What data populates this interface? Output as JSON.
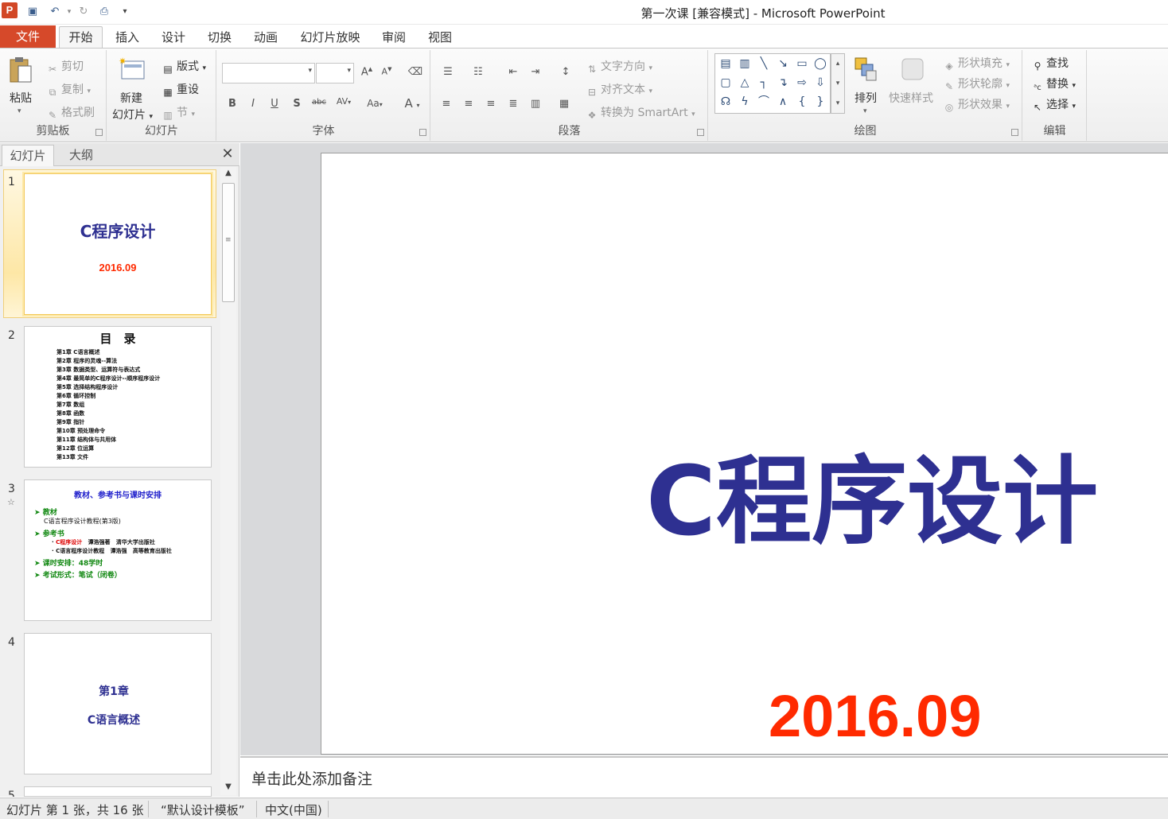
{
  "window": {
    "title": "第一次课 [兼容模式] - Microsoft PowerPoint"
  },
  "tabs": [
    "文件",
    "开始",
    "插入",
    "设计",
    "切换",
    "动画",
    "幻灯片放映",
    "审阅",
    "视图"
  ],
  "ribbon": {
    "clipboard": {
      "label": "剪贴板",
      "paste": "粘贴",
      "cut": "剪切",
      "copy": "复制",
      "format_painter": "格式刷"
    },
    "slides": {
      "label": "幻灯片",
      "new_slide_1": "新建",
      "new_slide_2": "幻灯片",
      "layout": "版式",
      "reset": "重设",
      "section": "节"
    },
    "font": {
      "label": "字体"
    },
    "paragraph": {
      "label": "段落",
      "text_direction": "文字方向",
      "align_text": "对齐文本",
      "smartart": "转换为 SmartArt"
    },
    "drawing": {
      "label": "绘图",
      "arrange": "排列",
      "quick_styles": "快速样式",
      "shape_fill": "形状填充",
      "shape_outline": "形状轮廓",
      "shape_effects": "形状效果"
    },
    "editing": {
      "label": "编辑",
      "find": "查找",
      "replace": "替换",
      "select": "选择"
    }
  },
  "pane": {
    "tab_slides": "幻灯片",
    "tab_outline": "大纲"
  },
  "thumbnails": [
    {
      "num": "1",
      "title": "C程序设计",
      "date": "2016.09"
    },
    {
      "num": "2",
      "title": "目　录",
      "items": [
        "第1章 C语言概述",
        "第2章 程序的灵魂--算法",
        "第3章 数据类型、运算符与表达式",
        "第4章 最简单的C程序设计--顺序程序设计",
        "第5章 选择结构程序设计",
        "第6章 循环控制",
        "第7章 数组",
        "第8章 函数",
        "第9章 指针",
        "第10章 预处理命令",
        "第11章 结构体与共用体",
        "第12章 位运算",
        "第13章 文件"
      ]
    },
    {
      "num": "3",
      "title": "教材、参考书与课时安排",
      "l1": "教材",
      "l2": "C语言程序设计教程(第3版)",
      "l3": "参考书",
      "l4a": "C程序设计",
      "l4b": "谭浩强著",
      "l4c": "清华大学出版社",
      "l5a": "C语言程序设计教程",
      "l5b": "谭浩强",
      "l5c": "高等教育出版社",
      "l6": "课时安排：48学时",
      "l7": "考试形式：笔试（闭卷）"
    },
    {
      "num": "4",
      "line1": "第1章",
      "line2": "C语言概述"
    },
    {
      "num": "5"
    }
  ],
  "slide": {
    "title": "C程序设计",
    "date": "2016.09"
  },
  "notes": {
    "placeholder": "单击此处添加备注"
  },
  "status": {
    "slide_info": "幻灯片 第 1 张，共 16 张",
    "theme": "“默认设计模板”",
    "language": "中文(中国)"
  },
  "colors": {
    "title_blue": "#2e3091",
    "date_red": "#ff2a00",
    "file_tab": "#d6492a"
  }
}
